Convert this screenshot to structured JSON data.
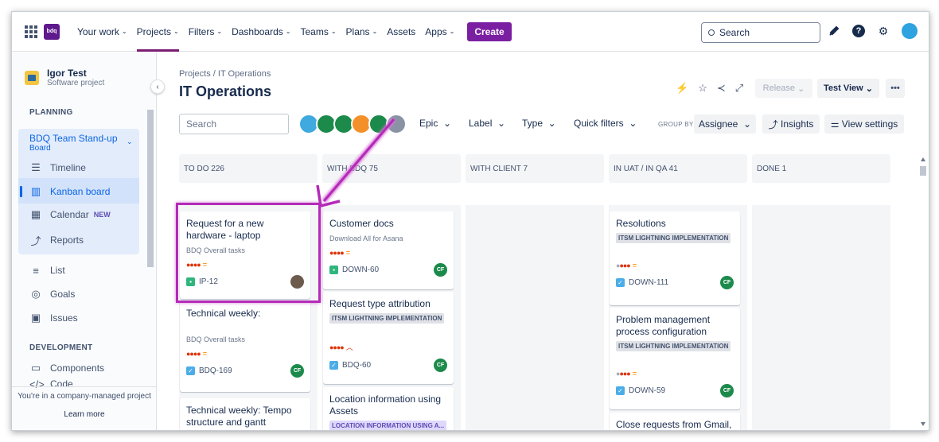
{
  "topnav": {
    "logo": "bdq",
    "items": [
      "Your work",
      "Projects",
      "Filters",
      "Dashboards",
      "Teams",
      "Plans",
      "Assets",
      "Apps"
    ],
    "create": "Create",
    "search": "Search"
  },
  "sidebar": {
    "project_name": "Igor Test",
    "project_type": "Software project",
    "planning_label": "PLANNING",
    "board_name": "BDQ Team Stand-up",
    "board_sub": "Board",
    "timeline": "Timeline",
    "kanban": "Kanban board",
    "calendar": "Calendar",
    "new_badge": "NEW",
    "reports": "Reports",
    "list": "List",
    "goals": "Goals",
    "issues": "Issues",
    "development_label": "DEVELOPMENT",
    "components": "Components",
    "code": "Code",
    "footer": "You're in a company-managed project",
    "learn_more": "Learn more"
  },
  "header": {
    "breadcrumb": "Projects  /  IT Operations",
    "title": "IT Operations",
    "release": "Release",
    "view": "Test View",
    "more": "•••"
  },
  "toolbar": {
    "search": "Search",
    "epic": "Epic",
    "label": "Label",
    "type": "Type",
    "quick_filters": "Quick filters",
    "group_by": "GROUP BY",
    "assignee": "Assignee",
    "insights": "Insights",
    "view_settings": "View settings"
  },
  "columns": [
    {
      "title": "TO DO 226"
    },
    {
      "title": "WITH BDQ 75"
    },
    {
      "title": "WITH CLIENT 7"
    },
    {
      "title": "IN UAT / IN QA 41"
    },
    {
      "title": "DONE 1"
    }
  ],
  "cards": {
    "c1": {
      "title": "Request for a new hardware - laptop",
      "sub": "BDQ Overall tasks",
      "key": "IP-12"
    },
    "c2": {
      "title": "Technical weekly:",
      "sub": "BDQ Overall tasks",
      "key": "BDQ-169",
      "avatar": "CF"
    },
    "c3": {
      "title": "Technical weekly: Tempo structure and gantt"
    },
    "c4": {
      "title": "Customer docs",
      "sub": "Download All for Asana",
      "key": "DOWN-60",
      "avatar": "CF"
    },
    "c5": {
      "title": "Request type attribution",
      "label": "ITSM LIGHTNING IMPLEMENTATION",
      "key": "BDQ-60",
      "avatar": "CF"
    },
    "c6": {
      "title": "Location information using Assets",
      "label": "LOCATION INFORMATION USING A..."
    },
    "c7": {
      "title": "Resolutions",
      "label": "ITSM LIGHTNING IMPLEMENTATION",
      "key": "DOWN-111",
      "avatar": "CF"
    },
    "c8": {
      "title": "Problem management process configuration",
      "label": "ITSM LIGHTNING IMPLEMENTATION",
      "key": "DOWN-59",
      "avatar": "CF"
    },
    "c9": {
      "title": "Close requests from Gmail,"
    }
  },
  "colors": {
    "accent": "#7b1fa2",
    "highlight": "#b42bb8",
    "link": "#0c66e4"
  }
}
